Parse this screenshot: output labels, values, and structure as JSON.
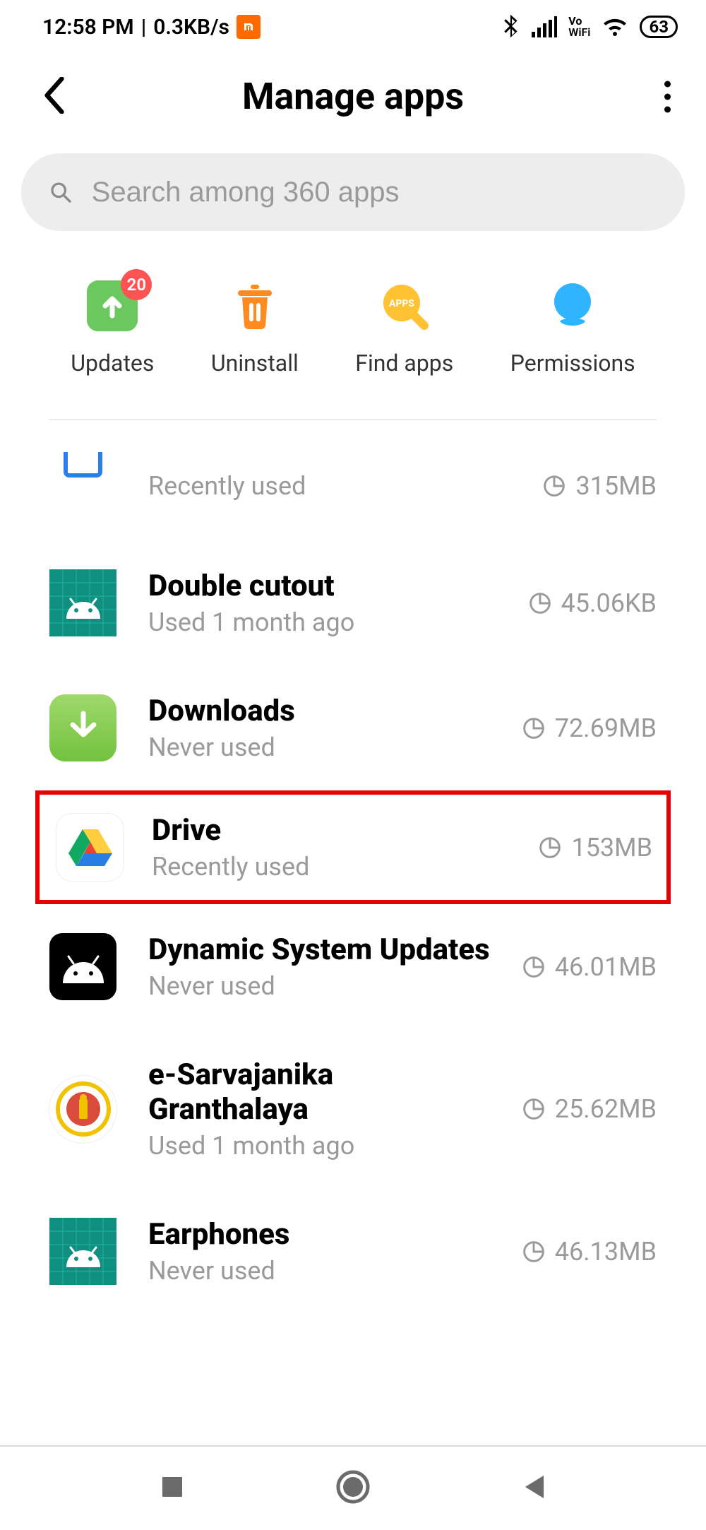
{
  "status": {
    "time": "12:58 PM",
    "net": "0.3KB/s",
    "vo_top": "Vo",
    "vo_bot": "WiFi",
    "battery": "63"
  },
  "header": {
    "title": "Manage apps"
  },
  "search": {
    "placeholder": "Search among 360 apps"
  },
  "quick": {
    "updates": {
      "label": "Updates",
      "badge": "20"
    },
    "uninstall": {
      "label": "Uninstall"
    },
    "find": {
      "label": "Find apps",
      "icon_text": "APPS"
    },
    "permissions": {
      "label": "Permissions"
    }
  },
  "apps": [
    {
      "name": "",
      "sub": "Recently used",
      "size": "315MB"
    },
    {
      "name": "Double cutout",
      "sub": "Used 1 month ago",
      "size": "45.06KB"
    },
    {
      "name": "Downloads",
      "sub": "Never used",
      "size": "72.69MB"
    },
    {
      "name": "Drive",
      "sub": "Recently used",
      "size": "153MB"
    },
    {
      "name": "Dynamic System Updates",
      "sub": "Never used",
      "size": "46.01MB"
    },
    {
      "name": "e-Sarvajanika Granthalaya",
      "sub": "Used 1 month ago",
      "size": "25.62MB"
    },
    {
      "name": "Earphones",
      "sub": "Never used",
      "size": "46.13MB"
    }
  ]
}
